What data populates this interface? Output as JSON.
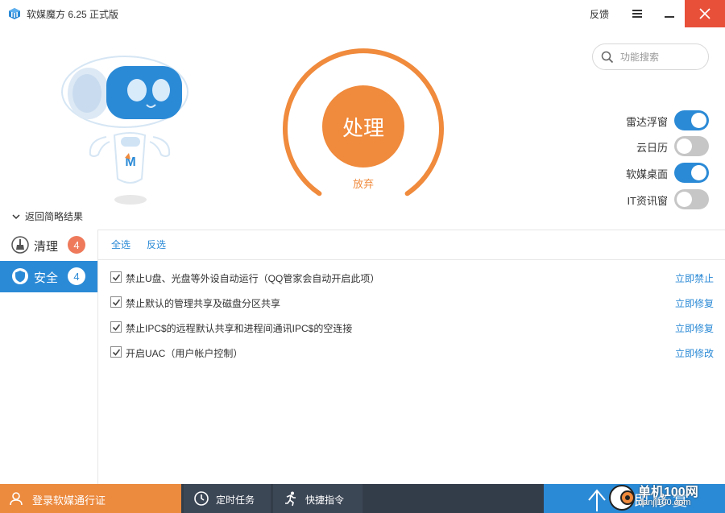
{
  "window": {
    "title": "软媒魔方 6.25 正式版",
    "feedback_label": "反馈"
  },
  "hero": {
    "process_label": "处理",
    "abandon_label": "放弃"
  },
  "search": {
    "placeholder": "功能搜索"
  },
  "toggles": [
    {
      "label": "雷达浮窗",
      "state": "on"
    },
    {
      "label": "云日历",
      "state": "off"
    },
    {
      "label": "软媒桌面",
      "state": "on"
    },
    {
      "label": "IT资讯窗",
      "state": "off"
    }
  ],
  "back_link": "返回简略结果",
  "sidebar": {
    "items": [
      {
        "label": "清理",
        "count": "4",
        "icon": "broom-icon",
        "selected": false
      },
      {
        "label": "安全",
        "count": "4",
        "icon": "shield-icon",
        "selected": true
      }
    ]
  },
  "list": {
    "select_all": "全选",
    "invert": "反选",
    "items": [
      {
        "text": "禁止U盘、光盘等外设自动运行（QQ管家会自动开启此项）",
        "action": "立即禁止",
        "checked": true
      },
      {
        "text": "禁止默认的管理共享及磁盘分区共享",
        "action": "立即修复",
        "checked": true
      },
      {
        "text": "禁止IPC$的远程默认共享和进程间通讯IPC$的空连接",
        "action": "立即修复",
        "checked": true
      },
      {
        "text": "开启UAC（用户帐户控制）",
        "action": "立即修改",
        "checked": true
      }
    ]
  },
  "bottombar": {
    "login_label": "登录软媒通行证",
    "timer_label": "定时任务",
    "quick_label": "快捷指令",
    "fix_label": "立即修复"
  },
  "watermark": {
    "line1": "单机100网",
    "line2": "danji100.com"
  },
  "colors": {
    "accent_blue": "#2b8ad6",
    "accent_orange": "#f08a3c",
    "close_red": "#e8503a",
    "badge_red": "#ee7a5b",
    "bottom_dark": "#333d4a"
  }
}
